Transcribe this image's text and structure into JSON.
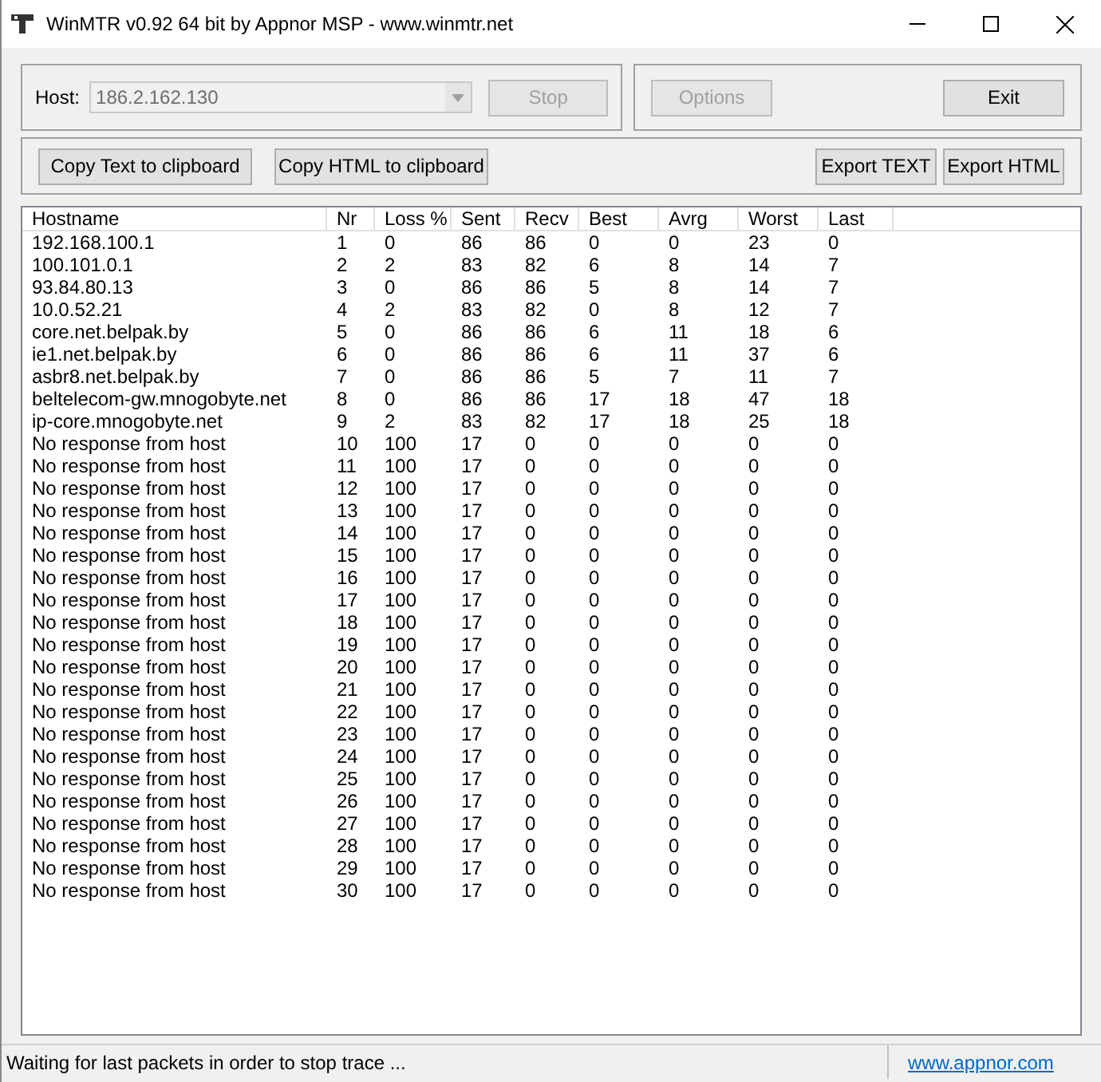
{
  "window": {
    "title": "WinMTR v0.92 64 bit by Appnor MSP - www.winmtr.net"
  },
  "host": {
    "label": "Host:",
    "value": "186.2.162.130",
    "disabled": true
  },
  "buttons_top_left": [
    {
      "label": "Stop",
      "disabled": true
    }
  ],
  "buttons_top_right": [
    {
      "label": "Options",
      "disabled": true
    },
    {
      "label": "Exit",
      "disabled": false
    }
  ],
  "buttons_copy": [
    {
      "label": "Copy Text to clipboard"
    },
    {
      "label": "Copy HTML to clipboard"
    }
  ],
  "buttons_export": [
    {
      "label": "Export TEXT"
    },
    {
      "label": "Export HTML"
    }
  ],
  "table": {
    "columns": [
      "Hostname",
      "Nr",
      "Loss %",
      "Sent",
      "Recv",
      "Best",
      "Avrg",
      "Worst",
      "Last"
    ],
    "rows": [
      [
        "192.168.100.1",
        "1",
        "0",
        "86",
        "86",
        "0",
        "0",
        "23",
        "0"
      ],
      [
        "100.101.0.1",
        "2",
        "2",
        "83",
        "82",
        "6",
        "8",
        "14",
        "7"
      ],
      [
        "93.84.80.13",
        "3",
        "0",
        "86",
        "86",
        "5",
        "8",
        "14",
        "7"
      ],
      [
        "10.0.52.21",
        "4",
        "2",
        "83",
        "82",
        "0",
        "8",
        "12",
        "7"
      ],
      [
        "core.net.belpak.by",
        "5",
        "0",
        "86",
        "86",
        "6",
        "11",
        "18",
        "6"
      ],
      [
        "ie1.net.belpak.by",
        "6",
        "0",
        "86",
        "86",
        "6",
        "11",
        "37",
        "6"
      ],
      [
        "asbr8.net.belpak.by",
        "7",
        "0",
        "86",
        "86",
        "5",
        "7",
        "11",
        "7"
      ],
      [
        "beltelecom-gw.mnogobyte.net",
        "8",
        "0",
        "86",
        "86",
        "17",
        "18",
        "47",
        "18"
      ],
      [
        "ip-core.mnogobyte.net",
        "9",
        "2",
        "83",
        "82",
        "17",
        "18",
        "25",
        "18"
      ],
      [
        "No response from host",
        "10",
        "100",
        "17",
        "0",
        "0",
        "0",
        "0",
        "0"
      ],
      [
        "No response from host",
        "11",
        "100",
        "17",
        "0",
        "0",
        "0",
        "0",
        "0"
      ],
      [
        "No response from host",
        "12",
        "100",
        "17",
        "0",
        "0",
        "0",
        "0",
        "0"
      ],
      [
        "No response from host",
        "13",
        "100",
        "17",
        "0",
        "0",
        "0",
        "0",
        "0"
      ],
      [
        "No response from host",
        "14",
        "100",
        "17",
        "0",
        "0",
        "0",
        "0",
        "0"
      ],
      [
        "No response from host",
        "15",
        "100",
        "17",
        "0",
        "0",
        "0",
        "0",
        "0"
      ],
      [
        "No response from host",
        "16",
        "100",
        "17",
        "0",
        "0",
        "0",
        "0",
        "0"
      ],
      [
        "No response from host",
        "17",
        "100",
        "17",
        "0",
        "0",
        "0",
        "0",
        "0"
      ],
      [
        "No response from host",
        "18",
        "100",
        "17",
        "0",
        "0",
        "0",
        "0",
        "0"
      ],
      [
        "No response from host",
        "19",
        "100",
        "17",
        "0",
        "0",
        "0",
        "0",
        "0"
      ],
      [
        "No response from host",
        "20",
        "100",
        "17",
        "0",
        "0",
        "0",
        "0",
        "0"
      ],
      [
        "No response from host",
        "21",
        "100",
        "17",
        "0",
        "0",
        "0",
        "0",
        "0"
      ],
      [
        "No response from host",
        "22",
        "100",
        "17",
        "0",
        "0",
        "0",
        "0",
        "0"
      ],
      [
        "No response from host",
        "23",
        "100",
        "17",
        "0",
        "0",
        "0",
        "0",
        "0"
      ],
      [
        "No response from host",
        "24",
        "100",
        "17",
        "0",
        "0",
        "0",
        "0",
        "0"
      ],
      [
        "No response from host",
        "25",
        "100",
        "17",
        "0",
        "0",
        "0",
        "0",
        "0"
      ],
      [
        "No response from host",
        "26",
        "100",
        "17",
        "0",
        "0",
        "0",
        "0",
        "0"
      ],
      [
        "No response from host",
        "27",
        "100",
        "17",
        "0",
        "0",
        "0",
        "0",
        "0"
      ],
      [
        "No response from host",
        "28",
        "100",
        "17",
        "0",
        "0",
        "0",
        "0",
        "0"
      ],
      [
        "No response from host",
        "29",
        "100",
        "17",
        "0",
        "0",
        "0",
        "0",
        "0"
      ],
      [
        "No response from host",
        "30",
        "100",
        "17",
        "0",
        "0",
        "0",
        "0",
        "0"
      ]
    ]
  },
  "status_bar": {
    "message": "Waiting for last packets in order to stop trace ...",
    "link": "www.appnor.com"
  }
}
